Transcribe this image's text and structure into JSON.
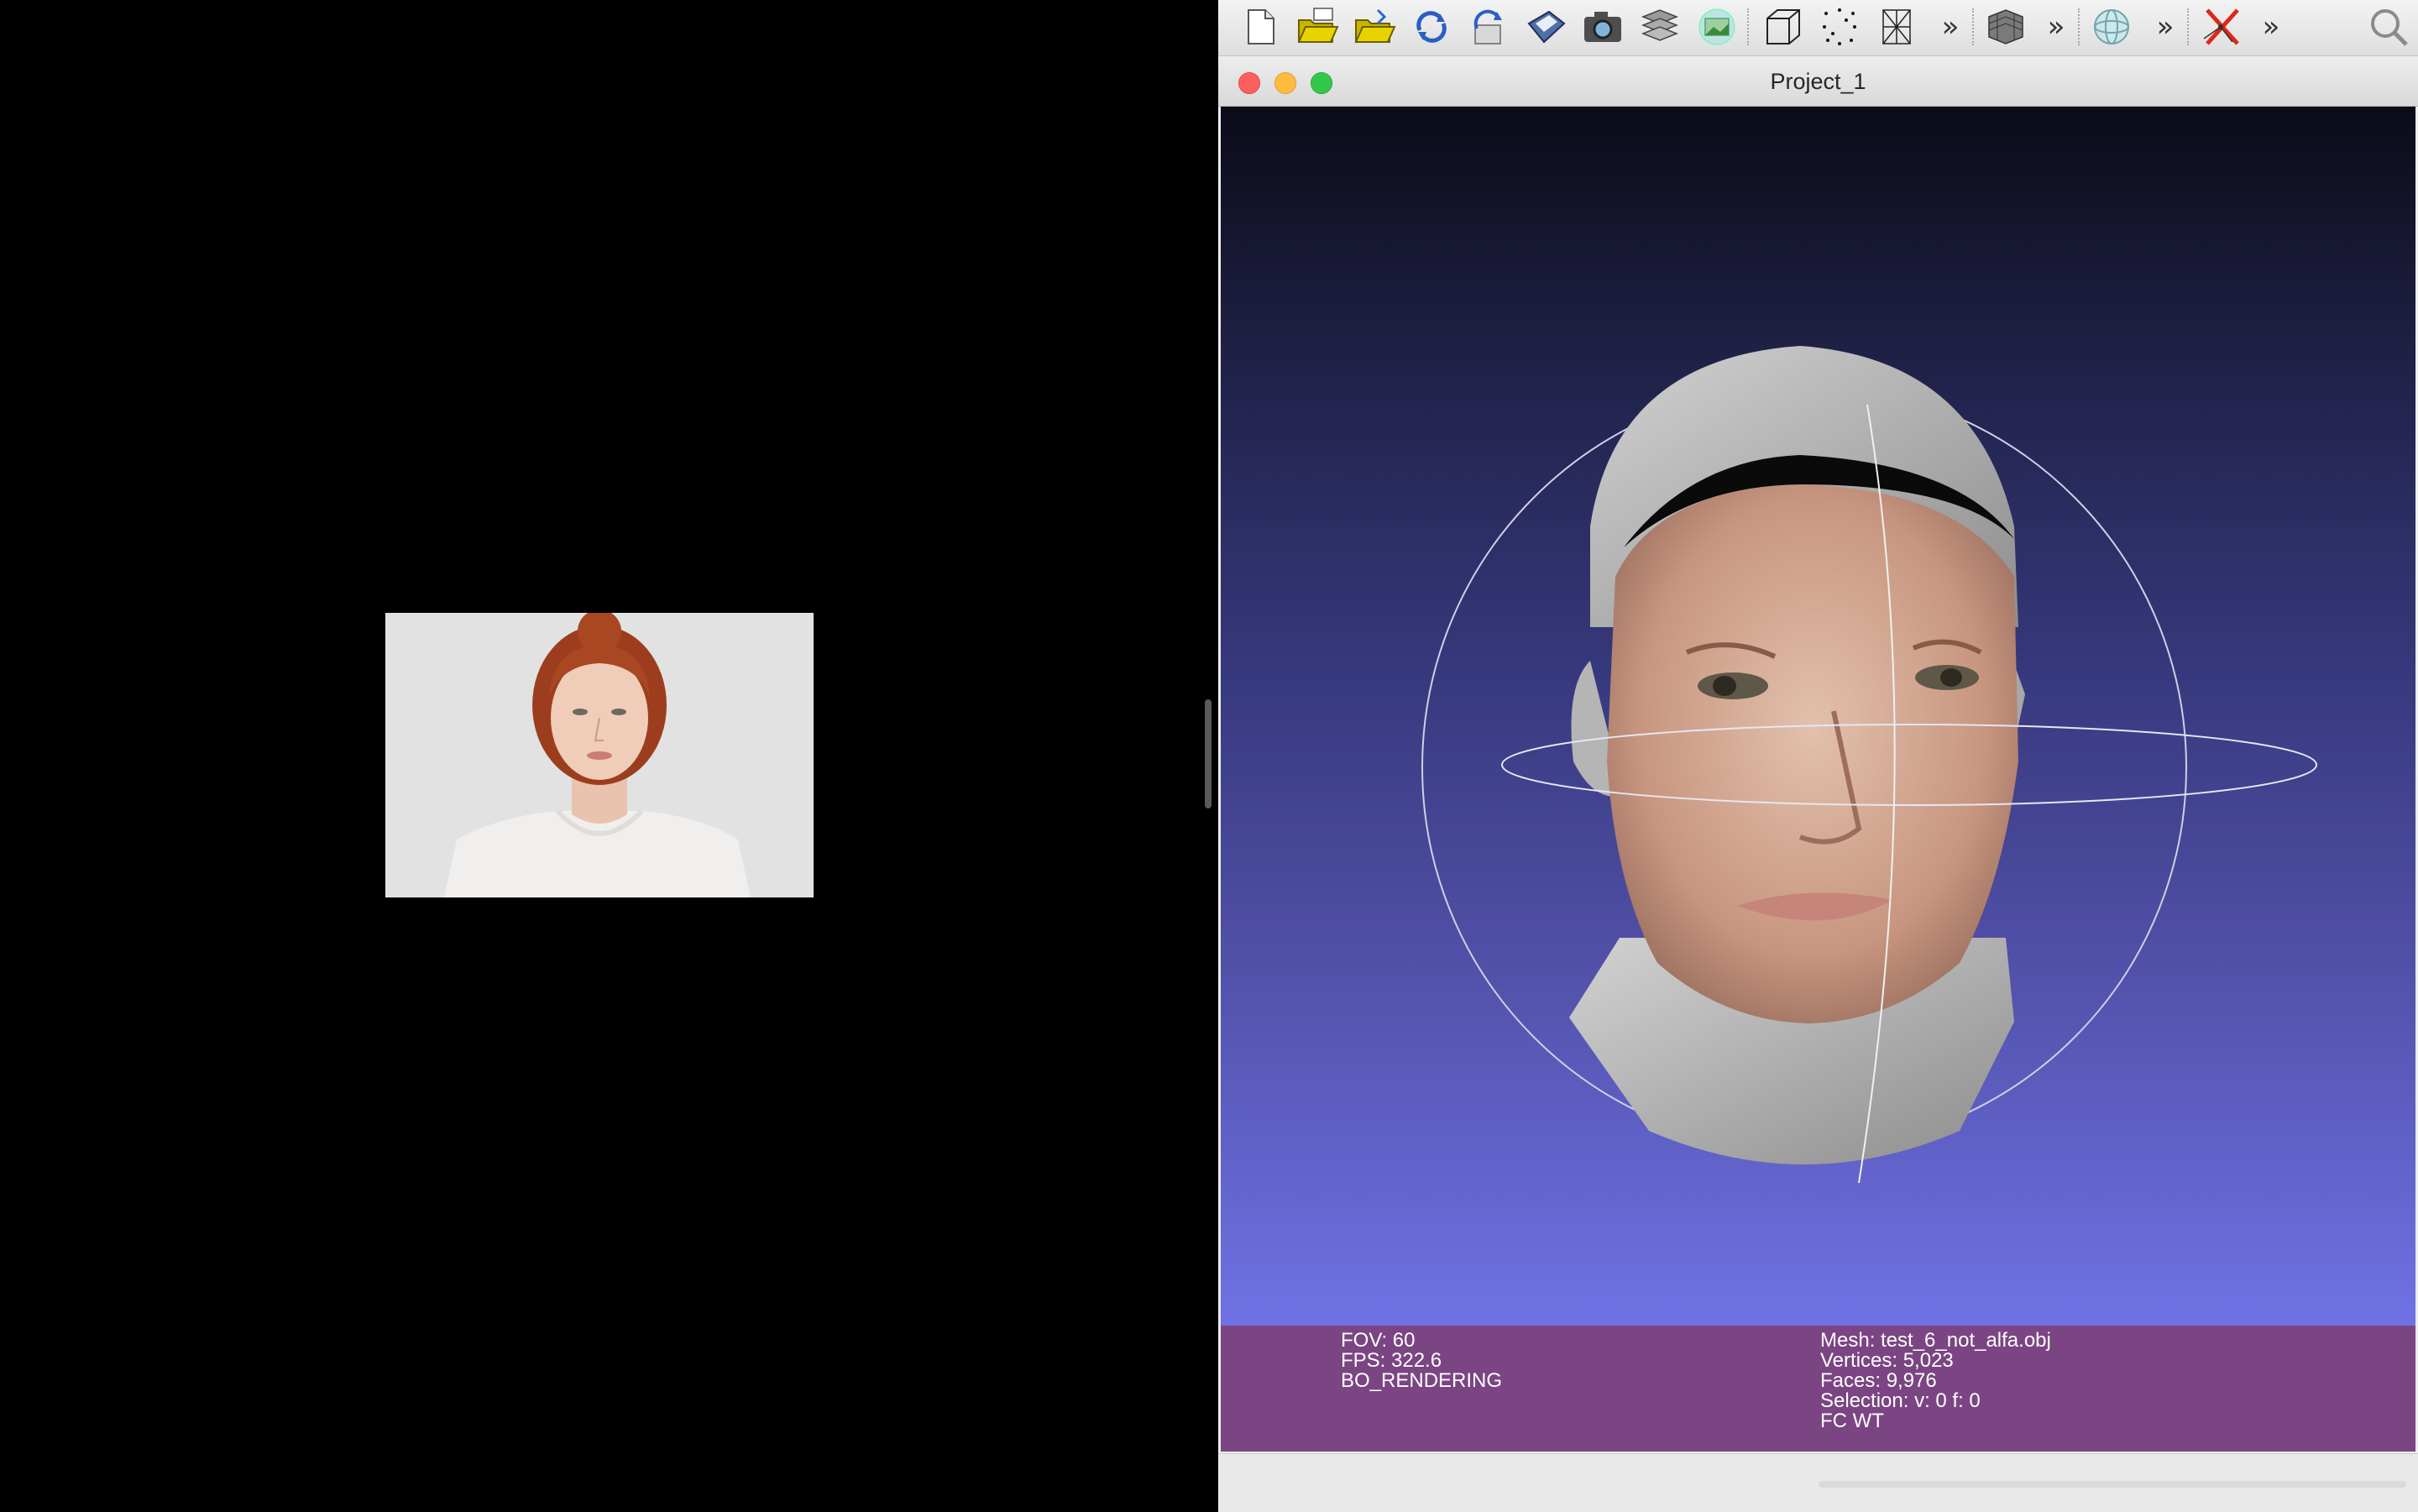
{
  "window": {
    "title": "Project_1"
  },
  "toolbar": {
    "icons": [
      "new-project-icon",
      "open-project-icon",
      "import-mesh-icon",
      "reload-icon",
      "reload-all-icon",
      "save-icon",
      "snapshot-icon",
      "layers-icon",
      "raster-icon",
      "bounding-box-icon",
      "points-icon",
      "wireframe-icon",
      "flat-lines-icon",
      "trackball-icon",
      "delete-icon",
      "search-icon"
    ],
    "overflow_glyph": "»"
  },
  "viewport": {
    "background_top": "#0b0b18",
    "background_bottom": "#6f72e5"
  },
  "info": {
    "left": {
      "fov": "FOV: 60",
      "fps": "FPS:   322.6",
      "mode": "BO_RENDERING"
    },
    "right": {
      "mesh": "Mesh: test_6_not_alfa.obj",
      "vertices": "Vertices: 5,023",
      "faces": "Faces: 9,976",
      "selection": "Selection: v: 0 f: 0",
      "flags": "FC WT"
    },
    "background": "#7b4583"
  },
  "colors": {
    "close": "#fc605c",
    "minimize": "#fdbc40",
    "zoom": "#34c84a"
  }
}
